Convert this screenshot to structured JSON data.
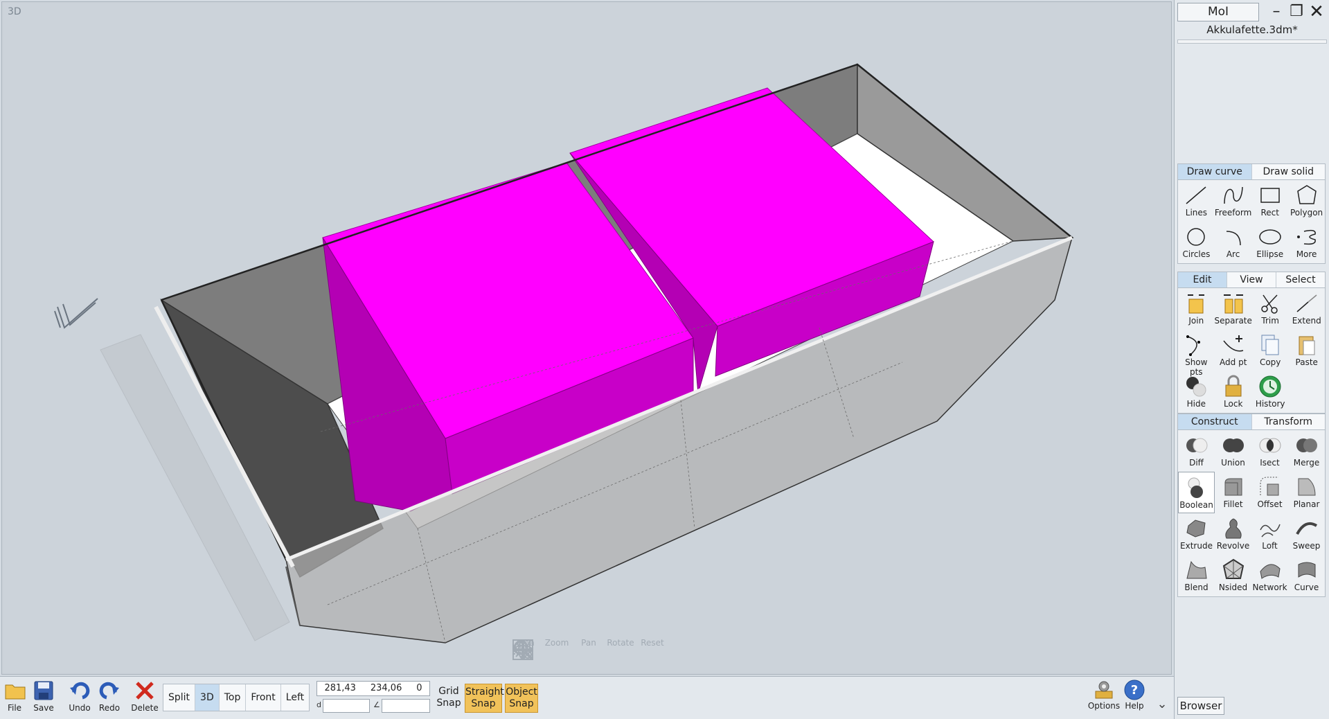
{
  "viewport": {
    "label": "3D",
    "nav_tools": [
      {
        "label": "Area",
        "icon": "area-zoom-icon"
      },
      {
        "label": "Zoom",
        "icon": "magnifier-icon"
      },
      {
        "label": "Pan",
        "icon": "pan-arrows-icon"
      },
      {
        "label": "Rotate",
        "icon": "rotate-icon"
      },
      {
        "label": "Reset",
        "icon": "reset-view-icon"
      }
    ],
    "colors": {
      "solid": "#ee00ee",
      "shell": "#8c8c8c",
      "background": "#ccd3da"
    }
  },
  "panel": {
    "app_button": "MoI",
    "doc_title": "Akkulafette.3dm*",
    "draw_tabs": [
      "Draw curve",
      "Draw solid"
    ],
    "draw_tools": [
      {
        "label": "Lines",
        "icon": "line-icon"
      },
      {
        "label": "Freeform",
        "icon": "freeform-curve-icon"
      },
      {
        "label": "Rect",
        "icon": "rectangle-icon"
      },
      {
        "label": "Polygon",
        "icon": "polygon-icon"
      },
      {
        "label": "Circles",
        "icon": "circle-icon"
      },
      {
        "label": "Arc",
        "icon": "arc-icon"
      },
      {
        "label": "Ellipse",
        "icon": "ellipse-icon"
      },
      {
        "label": "More",
        "icon": "spiral-icon"
      }
    ],
    "edit_tabs": [
      "Edit",
      "View",
      "Select"
    ],
    "edit_tools": [
      {
        "label": "Join",
        "icon": "join-icon"
      },
      {
        "label": "Separate",
        "icon": "separate-icon"
      },
      {
        "label": "Trim",
        "icon": "scissors-icon"
      },
      {
        "label": "Extend",
        "icon": "extend-icon"
      },
      {
        "label": "Show pts",
        "icon": "show-points-icon"
      },
      {
        "label": "Add pt",
        "icon": "add-point-icon"
      },
      {
        "label": "Copy",
        "icon": "copy-icon"
      },
      {
        "label": "Paste",
        "icon": "paste-icon"
      },
      {
        "label": "Hide",
        "icon": "hide-icon"
      },
      {
        "label": "Lock",
        "icon": "lock-icon"
      },
      {
        "label": "History",
        "icon": "history-icon"
      }
    ],
    "construct_tabs": [
      "Construct",
      "Transform"
    ],
    "construct_tools": [
      {
        "label": "Diff",
        "icon": "boolean-diff-icon"
      },
      {
        "label": "Union",
        "icon": "boolean-union-icon"
      },
      {
        "label": "Isect",
        "icon": "boolean-intersect-icon"
      },
      {
        "label": "Merge",
        "icon": "boolean-merge-icon"
      },
      {
        "label": "Boolean",
        "icon": "boolean-icon"
      },
      {
        "label": "Fillet",
        "icon": "fillet-icon"
      },
      {
        "label": "Offset",
        "icon": "offset-icon"
      },
      {
        "label": "Planar",
        "icon": "planar-icon"
      },
      {
        "label": "Extrude",
        "icon": "extrude-icon"
      },
      {
        "label": "Revolve",
        "icon": "revolve-icon"
      },
      {
        "label": "Loft",
        "icon": "loft-icon"
      },
      {
        "label": "Sweep",
        "icon": "sweep-icon"
      },
      {
        "label": "Blend",
        "icon": "blend-icon"
      },
      {
        "label": "Nsided",
        "icon": "nsided-icon"
      },
      {
        "label": "Network",
        "icon": "network-icon"
      },
      {
        "label": "Curve",
        "icon": "curve-surface-icon"
      }
    ]
  },
  "bottombar": {
    "file_buttons": [
      {
        "label": "File",
        "icon": "folder-icon"
      },
      {
        "label": "Save",
        "icon": "save-icon"
      },
      {
        "label": "Undo",
        "icon": "undo-icon"
      },
      {
        "label": "Redo",
        "icon": "redo-icon"
      },
      {
        "label": "Delete",
        "icon": "delete-x-icon"
      }
    ],
    "view_tabs": [
      "Split",
      "3D",
      "Top",
      "Front",
      "Left"
    ],
    "active_view": "3D",
    "coords": {
      "x": "281,43",
      "y": "234,06",
      "z": "0"
    },
    "distance_label": "d",
    "angle_label": "∠",
    "grid_snap": "Grid Snap",
    "straight_snap": "Straight Snap",
    "object_snap": "Object Snap",
    "options": {
      "label": "Options",
      "icon": "options-icon"
    },
    "help": {
      "label": "Help",
      "icon": "help-icon"
    },
    "browser": "Browser"
  }
}
